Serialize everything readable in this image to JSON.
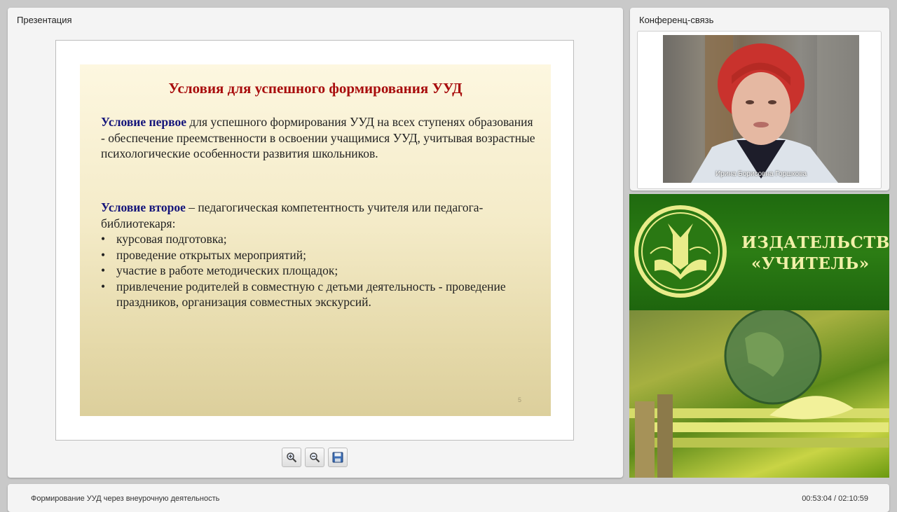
{
  "presentation": {
    "panel_title": "Презентация",
    "slide": {
      "title": "Условия для успешного формирования УУД",
      "condition1": {
        "label": "Условие первое",
        "text": " для успешного формирования УУД  на всех ступенях образования -  обеспечение преемственности в освоении учащимися УУД, учитывая возрастные психологические особенности развития школьников."
      },
      "condition2": {
        "label": "Условие  второе",
        "text": "  – педагогическая компетентность учителя  или педагога- библиотекаря:",
        "bullets": [
          "курсовая подготовка;",
          "проведение открытых мероприятий;",
          "участие в работе методических площадок;",
          "привлечение родителей в совместную с детьми деятельность - проведение праздников, организация совместных экскурсий."
        ]
      },
      "number": "5"
    },
    "toolbar": {
      "zoom_in_icon": "zoom-in-icon",
      "zoom_out_icon": "zoom-out-icon",
      "save_icon": "floppy-disk-icon"
    }
  },
  "conference": {
    "panel_title": "Конференц-связь",
    "speaker_name": "Ирина Борисовна Горшкова"
  },
  "ad": {
    "line1": "ИЗДАТЕЛЬСТВО",
    "line2": "«УЧИТЕЛЬ»",
    "colors": {
      "green": "#2c7d14",
      "text": "#f1f0a8"
    }
  },
  "footer": {
    "lecture_title": "Формирование УУД через внеурочную деятельность",
    "time": "00:53:04 / 02:10:59"
  }
}
